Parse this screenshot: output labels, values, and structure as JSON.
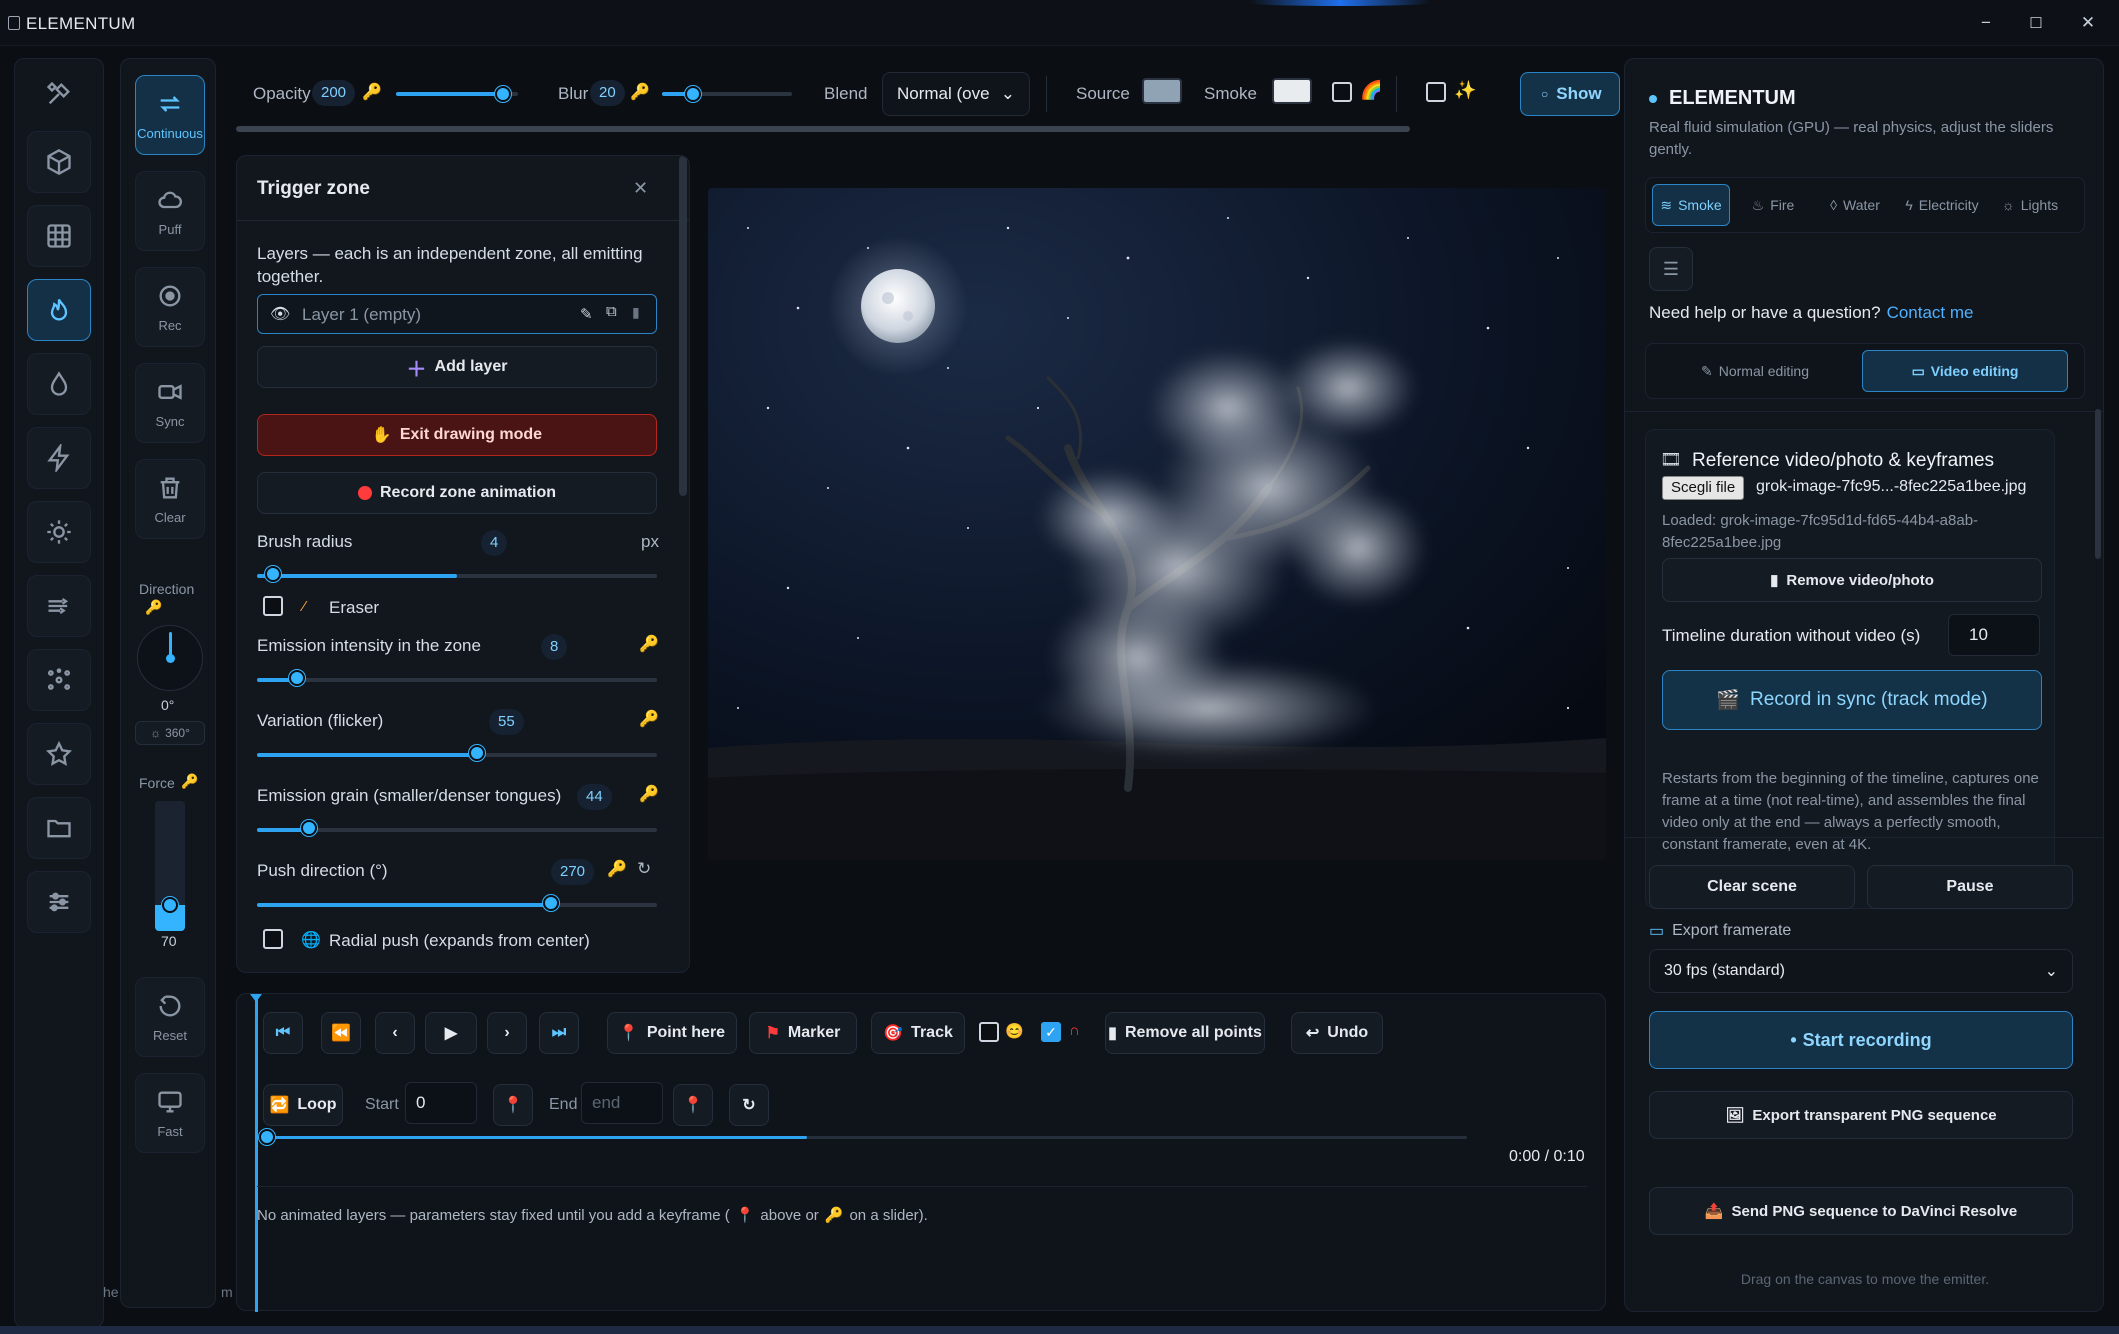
{
  "window": {
    "title": "ELEMENTUM",
    "minimize": "−",
    "maximize": "☐",
    "close": "✕"
  },
  "rail": {
    "icons": [
      "tools-icon",
      "cube-icon",
      "grid-icon",
      "flame-icon",
      "drop-icon",
      "bolt-icon",
      "sun-icon",
      "wind-icon",
      "particles-icon",
      "star-icon",
      "folder-icon",
      "sliders-icon"
    ],
    "active": "flame-icon"
  },
  "tools": {
    "continuous": "Continuous",
    "puff": "Puff",
    "rec": "Rec",
    "sync": "Sync",
    "clear": "Clear",
    "direction_label": "Direction",
    "direction_value": "0°",
    "direction_360": "360°",
    "force_label": "Force",
    "force_value": "70",
    "force_level": 0.2,
    "reset": "Reset",
    "fast": "Fast",
    "clip_left": "he",
    "clip_right": "m"
  },
  "topbar": {
    "opacity_label": "Opacity",
    "opacity_value": "200",
    "opacity_level": 0.88,
    "blur_label": "Blur",
    "blur_value": "20",
    "blur_level": 0.24,
    "blend_label": "Blend",
    "blend_value": "Normal (ove",
    "source_label": "Source",
    "smoke_label": "Smoke",
    "show_label": "Show",
    "source_color": "#8fa3b5",
    "smoke_color": "#e8ecef"
  },
  "trigger": {
    "title": "Trigger zone",
    "description": "Layers — each is an independent zone, all emitting together.",
    "layer_name": "Layer 1 (empty)",
    "add_layer": "Add layer",
    "exit_drawing": "Exit drawing mode",
    "record_zone": "Record zone animation",
    "brush_radius_label": "Brush radius",
    "brush_radius_value": "4",
    "brush_radius_unit": "px",
    "eraser_label": "Eraser",
    "emission_label": "Emission intensity in the zone",
    "emission_value": "8",
    "variation_label": "Variation (flicker)",
    "variation_value": "55",
    "grain_label": "Emission grain (smaller/denser tongues)",
    "grain_value": "44",
    "push_label": "Push direction (°)",
    "push_value": "270",
    "radial_label": "Radial push (expands from center)"
  },
  "timeline": {
    "point_here": "Point here",
    "marker": "Marker",
    "track": "Track",
    "remove_all": "Remove all points",
    "undo": "Undo",
    "loop": "Loop",
    "start_label": "Start",
    "start_value": "0",
    "end_label": "End",
    "end_placeholder": "end",
    "time": "0:00 / 0:10",
    "progress": 0.5,
    "note_1": "No animated layers — parameters stay fixed until you add a keyframe (",
    "note_2": "above or",
    "note_3": "on a slider)."
  },
  "right": {
    "title": "ELEMENTUM",
    "subtitle": "Real fluid simulation (GPU) — real physics, adjust the sliders gently.",
    "tabs": [
      "Smoke",
      "Fire",
      "Water",
      "Electricity",
      "Lights"
    ],
    "help_text": "Need help or have a question?",
    "contact": "Contact me",
    "normal_editing": "Normal editing",
    "video_editing": "Video editing",
    "ref_title": "Reference video/photo & keyframes",
    "choose_file": "Scegli file",
    "file_name": "grok-image-7fc95...-8fec225a1bee.jpg",
    "loaded": "Loaded: grok-image-7fc95d1d-fd65-44b4-a8ab-8fec225a1bee.jpg",
    "remove_video": "Remove video/photo",
    "timeline_duration_label": "Timeline duration without video (s)",
    "timeline_duration_value": "10",
    "record_sync": "Record in sync (track mode)",
    "info": "Restarts from the beginning of the timeline, captures one frame at a time (not real-time), and assembles the final video only at the end — always a perfectly smooth, constant framerate, even at 4K.",
    "clear_scene": "Clear scene",
    "pause": "Pause",
    "export_framerate": "Export framerate",
    "framerate_value": "30 fps (standard)",
    "start_recording": "Start recording",
    "export_png": "Export transparent PNG sequence",
    "send_davinci": "Send PNG sequence to DaVinci Resolve",
    "drag_hint": "Drag on the canvas to move the emitter."
  }
}
